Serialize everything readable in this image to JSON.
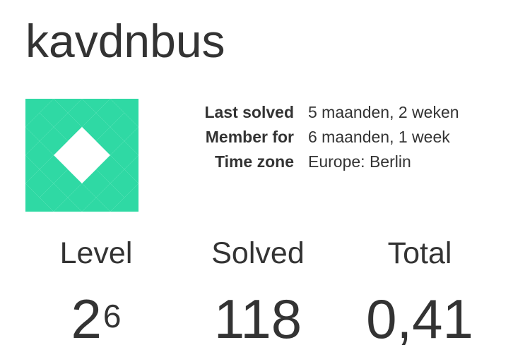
{
  "profile": {
    "username": "kavdnbus",
    "avatar_icon": "identicon-avatar",
    "avatar_color": "#2fd9a4"
  },
  "info": [
    {
      "label": "Last solved",
      "value": "5 maanden, 2 weken"
    },
    {
      "label": "Member for",
      "value": "6 maanden, 1 week"
    },
    {
      "label": "Time zone",
      "value": "Europe: Berlin"
    }
  ],
  "stats": {
    "level": {
      "label": "Level",
      "base": "2",
      "exponent": "6"
    },
    "solved": {
      "label": "Solved",
      "value": "118"
    },
    "total": {
      "label": "Total",
      "value": "0,41"
    }
  }
}
